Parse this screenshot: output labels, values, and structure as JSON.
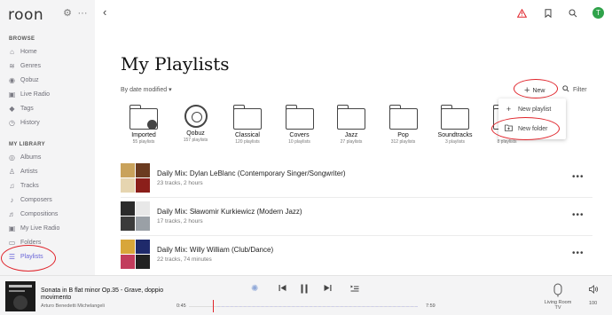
{
  "app": {
    "logo": "roon"
  },
  "sidebar": {
    "browse_title": "BROWSE",
    "browse_items": [
      {
        "label": "Home",
        "icon": "home-icon",
        "glyph": "⌂"
      },
      {
        "label": "Genres",
        "icon": "genres-icon",
        "glyph": "≋"
      },
      {
        "label": "Qobuz",
        "icon": "qobuz-icon",
        "glyph": "◉"
      },
      {
        "label": "Live Radio",
        "icon": "radio-icon",
        "glyph": "▣"
      },
      {
        "label": "Tags",
        "icon": "tag-icon",
        "glyph": "◆"
      },
      {
        "label": "History",
        "icon": "history-icon",
        "glyph": "◷"
      }
    ],
    "library_title": "MY LIBRARY",
    "library_items": [
      {
        "label": "Albums",
        "icon": "albums-icon",
        "glyph": "◎"
      },
      {
        "label": "Artists",
        "icon": "artists-icon",
        "glyph": "♙"
      },
      {
        "label": "Tracks",
        "icon": "tracks-icon",
        "glyph": "♫"
      },
      {
        "label": "Composers",
        "icon": "composers-icon",
        "glyph": "♪"
      },
      {
        "label": "Compositions",
        "icon": "compositions-icon",
        "glyph": "♬"
      },
      {
        "label": "My Live Radio",
        "icon": "my-live-radio-icon",
        "glyph": "▣"
      },
      {
        "label": "Folders",
        "icon": "folders-icon",
        "glyph": "▭"
      },
      {
        "label": "Playlists",
        "icon": "playlists-icon",
        "glyph": "☰",
        "active": true
      }
    ]
  },
  "main": {
    "title": "My Playlists",
    "sort_label": "By date modified ▾",
    "new_label": "New",
    "filter_label": "Filter",
    "folders": [
      {
        "name": "Imported",
        "count": "55 playlists",
        "type": "folder-badge"
      },
      {
        "name": "Qobuz",
        "count": "157 playlists",
        "type": "qobuz"
      },
      {
        "name": "Classical",
        "count": "120 playlists",
        "type": "folder"
      },
      {
        "name": "Covers",
        "count": "10 playlists",
        "type": "folder"
      },
      {
        "name": "Jazz",
        "count": "27 playlists",
        "type": "folder"
      },
      {
        "name": "Pop",
        "count": "312 playlists",
        "type": "folder"
      },
      {
        "name": "Soundtracks",
        "count": "3 playlists",
        "type": "folder"
      },
      {
        "name": "Rock",
        "count": "8 playlists",
        "type": "folder"
      }
    ],
    "new_menu": {
      "items": [
        {
          "label": "New playlist",
          "icon": "plus-icon",
          "glyph": "+"
        },
        {
          "label": "New folder",
          "icon": "new-folder-icon",
          "glyph": "⊞"
        }
      ]
    },
    "playlists": [
      {
        "title": "Daily Mix: Dylan LeBlanc (Contemporary Singer/Songwriter)",
        "subtitle": "23 tracks, 2 hours"
      },
      {
        "title": "Daily Mix: Sławomir Kurkiewicz (Modern Jazz)",
        "subtitle": "17 tracks, 2 hours"
      },
      {
        "title": "Daily Mix: Willy William (Club/Dance)",
        "subtitle": "22 tracks, 74 minutes"
      }
    ]
  },
  "player": {
    "track_title": "Sonata in B flat minor Op.35 - Grave, doppio movimento",
    "artist": "Arturo Benedetti Michelangeli",
    "elapsed": "0:45",
    "duration": "7:59",
    "zone": "Living Room TV",
    "volume": "100"
  },
  "colors": {
    "accent": "#6a65d8",
    "alert": "#e0242b",
    "avatar": "#2fa24a"
  },
  "avatar_initial": "T"
}
